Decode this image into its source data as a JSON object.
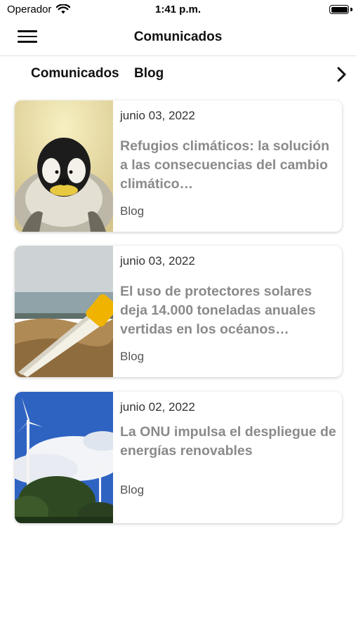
{
  "status_bar": {
    "carrier": "Operador",
    "time": "1:41 p.m."
  },
  "nav": {
    "title": "Comunicados",
    "menu_icon": "hamburger-menu-icon"
  },
  "tabs": [
    {
      "label": "Comunicados"
    },
    {
      "label": "Blog"
    }
  ],
  "tabs_more_icon": "chevron-right-icon",
  "articles": [
    {
      "date": "junio 03, 2022",
      "title": "Refugios climáticos: la solución a las consecuencias del cambio climático…",
      "category": "Blog",
      "image": "penguin-chick-photo"
    },
    {
      "date": "junio 03, 2022",
      "title": "El uso de protectores solares deja 14.000 toneladas anuales vertidas en los océanos…",
      "category": "Blog",
      "image": "sunscreen-tube-on-beach-photo"
    },
    {
      "date": "junio 02, 2022",
      "title": "La ONU impulsa el despliegue de energías renovables",
      "category": "Blog",
      "image": "wind-turbines-photo"
    }
  ],
  "colors": {
    "title_gray": "#8a8a8a",
    "divider": "#e2e2e2",
    "card_shadow": "rgba(0,0,0,0.22)"
  }
}
